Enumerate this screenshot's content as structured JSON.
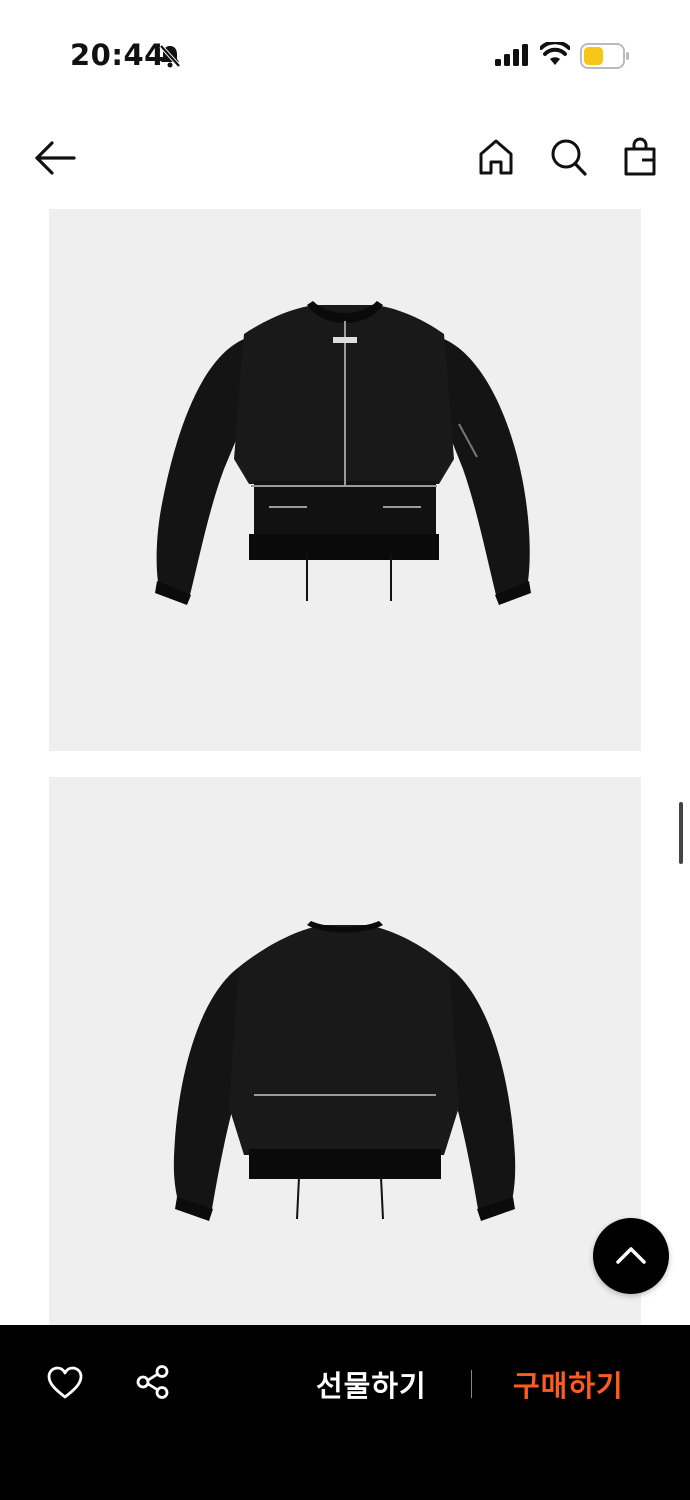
{
  "status_bar": {
    "time": "20:44",
    "icons": [
      "bell-slash-icon",
      "cellular-signal-icon",
      "wifi-icon",
      "battery-icon"
    ]
  },
  "header": {
    "icons": [
      "back-arrow-icon",
      "home-icon",
      "search-icon",
      "shopping-bag-icon"
    ]
  },
  "product_images": [
    {
      "view": "front",
      "subject": "black-bomber-jacket"
    },
    {
      "view": "back",
      "subject": "black-bomber-jacket"
    }
  ],
  "bottom_bar": {
    "gift_label": "선물하기",
    "buy_label": "구매하기",
    "icons": [
      "heart-icon",
      "share-icon"
    ]
  },
  "colors": {
    "buy_accent": "#ff5a1f",
    "bottom_bar_bg": "#000000",
    "image_bg": "#efefef",
    "battery_fill": "#f5c518"
  }
}
